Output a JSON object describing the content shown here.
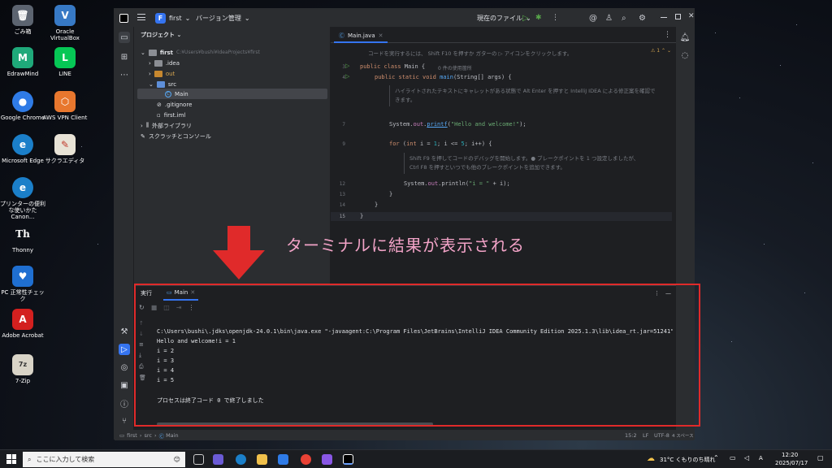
{
  "desktop": {
    "icons": [
      {
        "label": "ごみ箱",
        "glyph": "🗑",
        "color": "#5c6470"
      },
      {
        "label": "EdrawMind",
        "glyph": "M",
        "color": "#1fa97a"
      },
      {
        "label": "Google Chrome",
        "glyph": "●",
        "color": "#2f7be6"
      },
      {
        "label": "Microsoft Edge",
        "glyph": "e",
        "color": "#1b7fc9"
      },
      {
        "label": "プリンターの便利な使いかた Canon...",
        "glyph": "e",
        "color": "#1b7fc9"
      },
      {
        "label": "Thonny",
        "glyph": "Th",
        "color": "#2c2f35"
      },
      {
        "label": "PC 正常性チェック",
        "glyph": "♥",
        "color": "#1f6fd1"
      },
      {
        "label": "Adobe Acrobat",
        "glyph": "A",
        "color": "#d3201f"
      },
      {
        "label": "7-Zip",
        "glyph": "7z",
        "color": "#d9d4c7"
      },
      {
        "label": "Oracle VirtualBox",
        "glyph": "V",
        "color": "#3779c5"
      },
      {
        "label": "LINE",
        "glyph": "L",
        "color": "#06c755"
      },
      {
        "label": "AWS VPN Client",
        "glyph": "⬡",
        "color": "#e8772e"
      },
      {
        "label": "サクラエディタ",
        "glyph": "✎",
        "color": "#e8e3d6"
      }
    ]
  },
  "ide": {
    "project_badge": "F",
    "project_name": "first",
    "vcs_menu": "バージョン管理",
    "run_config": "現在のファイル",
    "project_panel_title": "プロジェクト",
    "tree": {
      "root": "first",
      "root_path": "C:¥Users¥bushi¥IdeaProjects¥first",
      "idea": ".idea",
      "out": "out",
      "src": "src",
      "main": "Main",
      "gitignore": ".gitignore",
      "iml": "first.iml",
      "external": "外部ライブラリ",
      "scratches": "スクラッチとコンソール"
    },
    "editor_tab": "Main.java",
    "warning_count": "1",
    "hints": {
      "run_hint": "コードを実行するには、 Shift F10 を押すか ガターの ▷ アイコンをクリックします。",
      "usage": "0 件の使用箇所",
      "fix_hint_1": "ハイライトされたテキストにキャレットがある状態で Alt Enter を押すと IntelliJ IDEA による修正案を確認で",
      "fix_hint_2": "きます。",
      "debug_hint_1": "Shift F9 を押してコードのデバッグを開始します。● ブレークポイントを 1 つ設定しましたが、",
      "debug_hint_2": "Ctrl F8 を押すといつでも他のブレークポイントを追加できます。"
    },
    "code": {
      "line3": "public class Main {",
      "line4": "public static void main(String[] args) {",
      "line7": "System.out.printf(\"Hello and welcome!\");",
      "line9": "for (int i = 1; i <= 5; i++) {",
      "line12": "System.out.println(\"i = \" + i);",
      "line13": "}",
      "line14": "}",
      "line15": "}"
    },
    "line_numbers": [
      "3",
      "4",
      "7",
      "9",
      "12",
      "13",
      "14",
      "15"
    ],
    "run_panel": {
      "title": "実行",
      "tab": "Main",
      "command": "C:\\Users\\bushi\\.jdks\\openjdk-24.0.1\\bin\\java.exe \"-javaagent:C:\\Program Files\\JetBrains\\IntelliJ IDEA Community Edition 2025.1.3\\lib\\idea_rt.jar=51241\" -Dfil",
      "output": [
        "Hello and welcome!i = 1",
        "i = 2",
        "i = 3",
        "i = 4",
        "i = 5",
        "",
        "プロセスは終了コード 0 で終了しました"
      ]
    },
    "status": {
      "breadcrumb": [
        "first",
        "src",
        "Main"
      ],
      "position": "15:2",
      "line_sep": "LF",
      "encoding": "UTF-8",
      "indent": "4 スペース"
    }
  },
  "annotation": "ターミナルに結果が表示される",
  "taskbar": {
    "search_placeholder": "ここに入力して検索",
    "weather": "31°C くもりのち晴れ",
    "time": "12:20",
    "date": "2025/07/17"
  }
}
